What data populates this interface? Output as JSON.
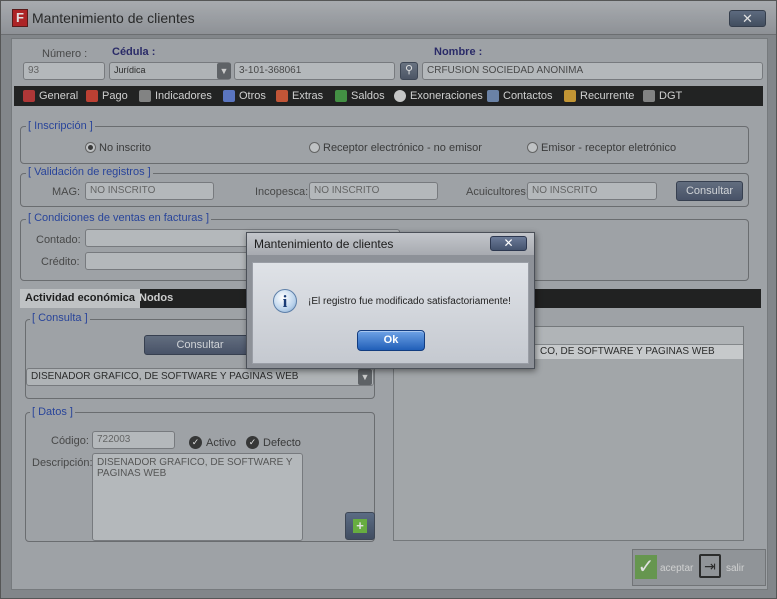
{
  "window": {
    "title": "Mantenimiento de clientes",
    "close_glyph": "✕"
  },
  "header": {
    "numero_label": "Número :",
    "numero_value": "93",
    "cedula_label": "Cédula :",
    "cedula_type": "Jurídica",
    "cedula_value": "3-101-368061",
    "nombre_label": "Nombre :",
    "nombre_value": "CRFUSION SOCIEDAD ANONIMA"
  },
  "tabs": [
    {
      "label": "General",
      "icon": "calendar-icon",
      "color": "#c22f2f"
    },
    {
      "label": "Pago",
      "icon": "arrows-icon",
      "color": "#d23a2a"
    },
    {
      "label": "Indicadores",
      "icon": "gear-icon",
      "color": "#8b8b8b"
    },
    {
      "label": "Otros",
      "icon": "list-icon",
      "color": "#5b7bd6"
    },
    {
      "label": "Extras",
      "icon": "table-icon",
      "color": "#d8532f"
    },
    {
      "label": "Saldos",
      "icon": "ledger-icon",
      "color": "#3f9c3f"
    },
    {
      "label": "Exoneraciones",
      "icon": "info-icon",
      "color": "#dddddd"
    },
    {
      "label": "Contactos",
      "icon": "person-icon",
      "color": "#6e8ab6"
    },
    {
      "label": "Recurrente",
      "icon": "calendar-icon",
      "color": "#d9a12b"
    },
    {
      "label": "DGT",
      "icon": "gear-icon",
      "color": "#8b8b8b"
    }
  ],
  "inscripcion": {
    "title": "[ Inscripción ]",
    "options": [
      {
        "label": "No inscrito",
        "selected": true
      },
      {
        "label": "Receptor electrónico - no emisor",
        "selected": false
      },
      {
        "label": "Emisor - receptor eletrónico",
        "selected": false
      }
    ]
  },
  "validacion": {
    "title": "[ Validación de registros ]",
    "mag_label": "MAG:",
    "mag_value": "NO INSCRITO",
    "incopesca_label": "Incopesca:",
    "incopesca_value": "NO INSCRITO",
    "acuicultores_label": "Acuicultores:",
    "acuicultores_value": "NO INSCRITO",
    "consultar_label": "Consultar"
  },
  "condiciones": {
    "title": "[ Condiciones de ventas en facturas ]",
    "contado_label": "Contado:",
    "credito_label": "Crédito:"
  },
  "subtabs": [
    {
      "label": "Actividad económica",
      "active": true
    },
    {
      "label": "Nodos",
      "active": false
    }
  ],
  "consulta": {
    "title": "[ Consulta ]",
    "consultar_label": "Consultar",
    "actividad_value": "DISENADOR GRAFICO, DE SOFTWARE Y PAGINAS WEB"
  },
  "datos": {
    "title": "[ Datos ]",
    "codigo_label": "Código:",
    "codigo_value": "722003",
    "activo_label": "Activo",
    "defecto_label": "Defecto",
    "descripcion_label": "Descripción:",
    "descripcion_value": "DISENADOR GRAFICO, DE SOFTWARE Y PAGINAS WEB"
  },
  "grid": {
    "row_text": "CO, DE SOFTWARE Y PAGINAS WEB"
  },
  "footer": {
    "aceptar_label": "aceptar",
    "salir_label": "salir"
  },
  "dialog": {
    "title": "Mantenimiento de clientes",
    "close_glyph": "✕",
    "message": "¡El registro fue modificado satisfactoriamente!",
    "ok_label": "Ok",
    "info_glyph": "i"
  }
}
